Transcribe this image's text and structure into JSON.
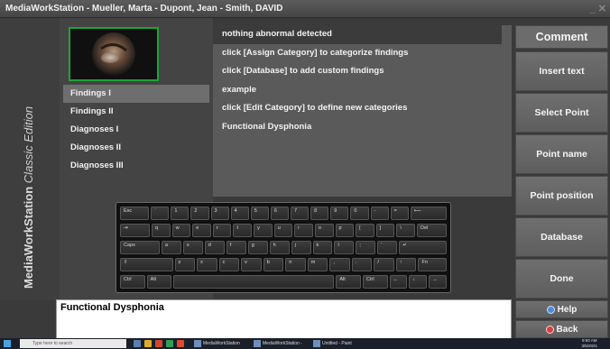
{
  "window": {
    "title": "MediaWorkStation - Mueller, Marta - Dupont, Jean - Smith, DAVID",
    "minimize_glyph": "_",
    "close_glyph": "✕"
  },
  "brand": {
    "name": "MediaWorkStation",
    "edition": "Classic Edition"
  },
  "categories": [
    {
      "label": "Findings I",
      "selected": true
    },
    {
      "label": "Findings II",
      "selected": false
    },
    {
      "label": "Diagnoses I",
      "selected": false
    },
    {
      "label": "Diagnoses II",
      "selected": false
    },
    {
      "label": "Diagnoses III",
      "selected": false
    }
  ],
  "findings": [
    {
      "label": "nothing abnormal detected",
      "selected": true
    },
    {
      "label": "click [Assign Category] to categorize findings",
      "selected": false
    },
    {
      "label": "click [Database] to add custom findings",
      "selected": false
    },
    {
      "label": "example",
      "selected": false
    },
    {
      "label": "click [Edit Category] to define new categories",
      "selected": false
    },
    {
      "label": "Functional Dysphonia",
      "selected": false
    }
  ],
  "right_buttons": {
    "comment": "Comment",
    "insert_text": "Insert text",
    "select_point": "Select Point",
    "point_name": "Point name",
    "point_position": "Point position",
    "database": "Database",
    "done": "Done",
    "help": "Help",
    "back": "Back"
  },
  "keyboard": {
    "rows": [
      [
        "Esc",
        "`",
        "1",
        "2",
        "3",
        "4",
        "5",
        "6",
        "7",
        "8",
        "9",
        "0",
        "-",
        "=",
        "⟵"
      ],
      [
        "⇥",
        "q",
        "w",
        "e",
        "r",
        "t",
        "y",
        "u",
        "i",
        "o",
        "p",
        "[",
        "]",
        "\\",
        "Del"
      ],
      [
        "Caps",
        "a",
        "s",
        "d",
        "f",
        "g",
        "h",
        "j",
        "k",
        "l",
        ";",
        "'",
        "↵"
      ],
      [
        "⇧",
        "z",
        "x",
        "c",
        "v",
        "b",
        "n",
        "m",
        ",",
        ".",
        "/",
        "↑",
        "Fn"
      ],
      [
        "Ctrl",
        "Alt",
        "",
        "Alt",
        "Ctrl",
        "←",
        "↓",
        "→"
      ]
    ]
  },
  "comment_text": "Functional Dysphonia",
  "taskbar": {
    "search_placeholder": "Type here to search",
    "apps": [
      "MediaWorkStation",
      "MediaWorkStation - ...",
      "Untitled - Paint"
    ],
    "time": "9:50 AM",
    "date": "3/5/2021"
  },
  "colors": {
    "accent_green": "#1fa33a",
    "selected_category": "#6e6e6e",
    "selected_finding": "#3b3b3b"
  }
}
